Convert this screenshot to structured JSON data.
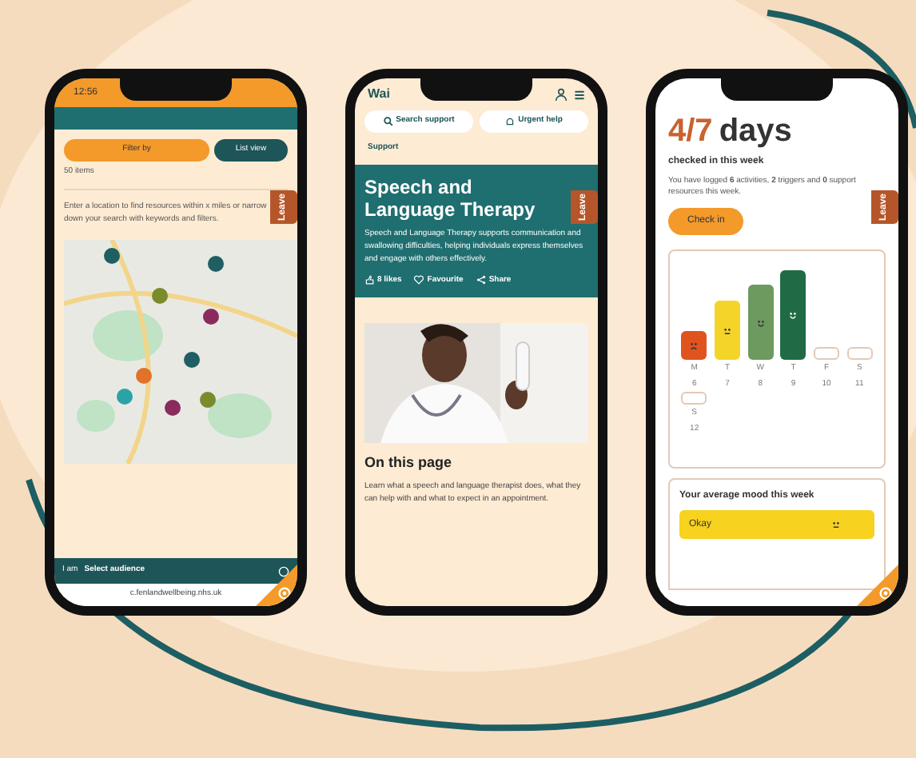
{
  "phones": [
    {
      "kind": "map",
      "status_time": "12:56",
      "filter_button": "Filter by",
      "list_button": "List view",
      "count": "50 items",
      "intro": "Enter a location to find resources within x miles or narrow down your search with keywords and filters.",
      "leave_tab": "Leave",
      "audience_prefix": "I am",
      "audience_select": "Select audience",
      "url": "c.fenlandwellbeing.nhs.uk"
    },
    {
      "kind": "article",
      "logo": "Wai",
      "search_button": "Search support",
      "urgent_button": "Urgent help",
      "back_link": "Support",
      "leave_tab": "Leave",
      "title": "Speech and Language Therapy",
      "description": "Speech and Language Therapy supports communication and swallowing difficulties, helping individuals express themselves and engage with others effectively.",
      "actions": [
        {
          "kind": "like",
          "label": "8 likes"
        },
        {
          "kind": "favourite",
          "label": "Favourite"
        },
        {
          "kind": "share",
          "label": "Share"
        }
      ],
      "section_heading": "On this page",
      "section_text": "Learn what a speech and language therapist does, what they can help with and what to expect in an appointment."
    },
    {
      "kind": "mood",
      "days_count": "4/7",
      "days_word": "days",
      "subtitle": "checked in this week",
      "summary": "You have logged **6** activities, **2** triggers and **0** support resources this week.",
      "leave_tab": "Leave",
      "checkin_button": "Check in",
      "days": [
        {
          "label": "M",
          "date": "6",
          "kind": "sad"
        },
        {
          "label": "T",
          "date": "7",
          "kind": "neutral"
        },
        {
          "label": "W",
          "date": "8",
          "kind": "happy"
        },
        {
          "label": "T",
          "date": "9",
          "kind": "very_happy"
        },
        {
          "label": "F",
          "date": "10",
          "kind": "none"
        },
        {
          "label": "S",
          "date": "11",
          "kind": "none"
        },
        {
          "label": "S",
          "date": "12",
          "kind": "none"
        }
      ],
      "average_heading": "Your average mood this week",
      "average_mood": "Okay"
    }
  ]
}
